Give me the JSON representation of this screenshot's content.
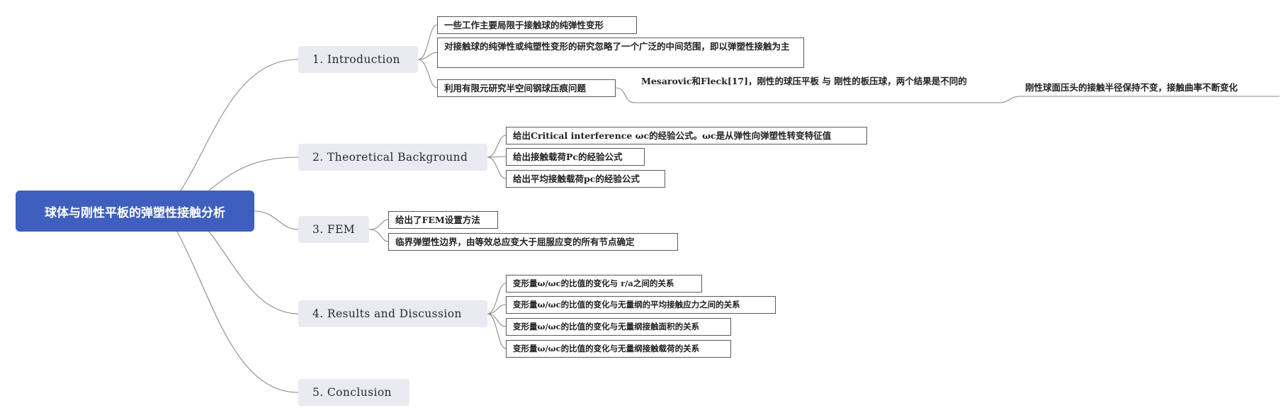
{
  "root": {
    "label": "球体与刚性平板的弹塑性接触分析"
  },
  "sections": [
    {
      "label": "1. Introduction",
      "items": [
        {
          "label": "一些工作主要局限于接触球的纯弹性变形"
        },
        {
          "label": "对接触球的纯弹性或纯塑性变形的研究忽略了一个广泛的中间范围，即以弹塑性接触为主"
        },
        {
          "label": "利用有限元研究半空间钢球压痕问题",
          "children": [
            {
              "label": "Mesarovic和Fleck[17]，刚性的球压平板 与 刚性的板压球，两个结果是不同的",
              "children": [
                {
                  "label": "刚性球面压头的接触半径保持不变，接触曲率不断变化"
                }
              ]
            }
          ]
        }
      ]
    },
    {
      "label": "2. Theoretical Background",
      "items": [
        {
          "label": "给出Critical interference ωc的经验公式。ωc是从弹性向弹塑性转变特征值"
        },
        {
          "label": "给出接触载荷Pc的经验公式"
        },
        {
          "label": "给出平均接触载荷pc的经验公式"
        }
      ]
    },
    {
      "label": "3. FEM",
      "items": [
        {
          "label": "给出了FEM设置方法"
        },
        {
          "label": "临界弹塑性边界，由等效总应变大于屈服应变的所有节点确定"
        }
      ]
    },
    {
      "label": "4. Results and Discussion",
      "items": [
        {
          "label": "变形量ω/ωc的比值的变化与 r/a之间的关系"
        },
        {
          "label": "变形量ω/ωc的比值的变化与无量纲的平均接触应力之间的关系"
        },
        {
          "label": "变形量ω/ωc的比值的变化与无量纲接触面积的关系"
        },
        {
          "label": "变形量ω/ωc的比值的变化与无量纲接触载荷的关系"
        }
      ]
    },
    {
      "label": "5. Conclusion",
      "items": []
    }
  ],
  "colors": {
    "root": "#3f5fbf",
    "topic": "#e9eaf2",
    "line": "#8a8a8a",
    "leaf_border": "#5a5a5a"
  }
}
